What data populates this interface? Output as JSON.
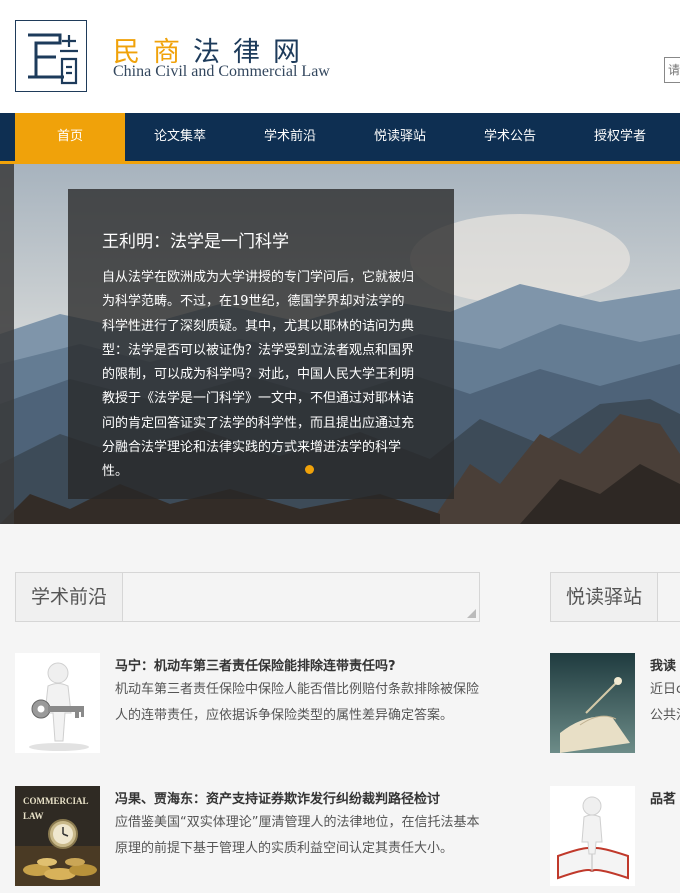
{
  "header": {
    "logo_alt": "民商",
    "brand_cn_primary": "民商",
    "brand_cn_secondary": "法律网",
    "brand_en": "China Civil and Commercial Law",
    "search_placeholder": "请"
  },
  "nav": {
    "items": [
      {
        "label": "首页",
        "active": true
      },
      {
        "label": "论文集萃",
        "active": false
      },
      {
        "label": "学术前沿",
        "active": false
      },
      {
        "label": "悦读驿站",
        "active": false
      },
      {
        "label": "学术公告",
        "active": false
      },
      {
        "label": "授权学者",
        "active": false
      }
    ]
  },
  "hero": {
    "title": "王利明：法学是一门科学",
    "text": "自从法学在欧洲成为大学讲授的专门学问后，它就被归为科学范畴。不过，在19世纪，德国学界却对法学的科学性进行了深刻质疑。其中，尤其以耶林的诘问为典型：法学是否可以被证伪？法学受到立法者观点和国界的限制，可以成为科学吗？对此，中国人民大学王利明教授于《法学是一门科学》一文中，不但通过对耶林诘问的肯定回答证实了法学的科学性，而且提出应通过充分融合法学理论和法律实践的方式来增进法学的科学性。"
  },
  "sections": {
    "frontier": {
      "title": "学术前沿",
      "articles": [
        {
          "title": "马宁：机动车第三者责任保险能排除连带责任吗?",
          "summary": "机动车第三者责任保险中保险人能否借比例赔付条款排除被保险人的连带责任，应依据诉争保险类型的属性差异确定答案。",
          "thumb_icon": "person-key-icon"
        },
        {
          "title": "冯果、贾海东：资产支持证券欺诈发行纠纷裁判路径检讨",
          "summary": "应借鉴美国“双实体理论”厘清管理人的法律地位，在信托法基本原理的前提下基于管理人的实质利益空间认定其责任大小。",
          "thumb_icon": "commercial-law-icon",
          "thumb_text_1": "COMMERCIAL",
          "thumb_text_2": "LAW"
        }
      ]
    },
    "reading": {
      "title": "悦读驿站",
      "articles": [
        {
          "title": "我读",
          "summary": "近日c公共法",
          "thumb_icon": "book-icon"
        },
        {
          "title": "品茗",
          "summary": "",
          "thumb_icon": "person-book-icon"
        }
      ]
    }
  },
  "colors": {
    "navy": "#0e2f52",
    "accent": "#f0a20a"
  }
}
